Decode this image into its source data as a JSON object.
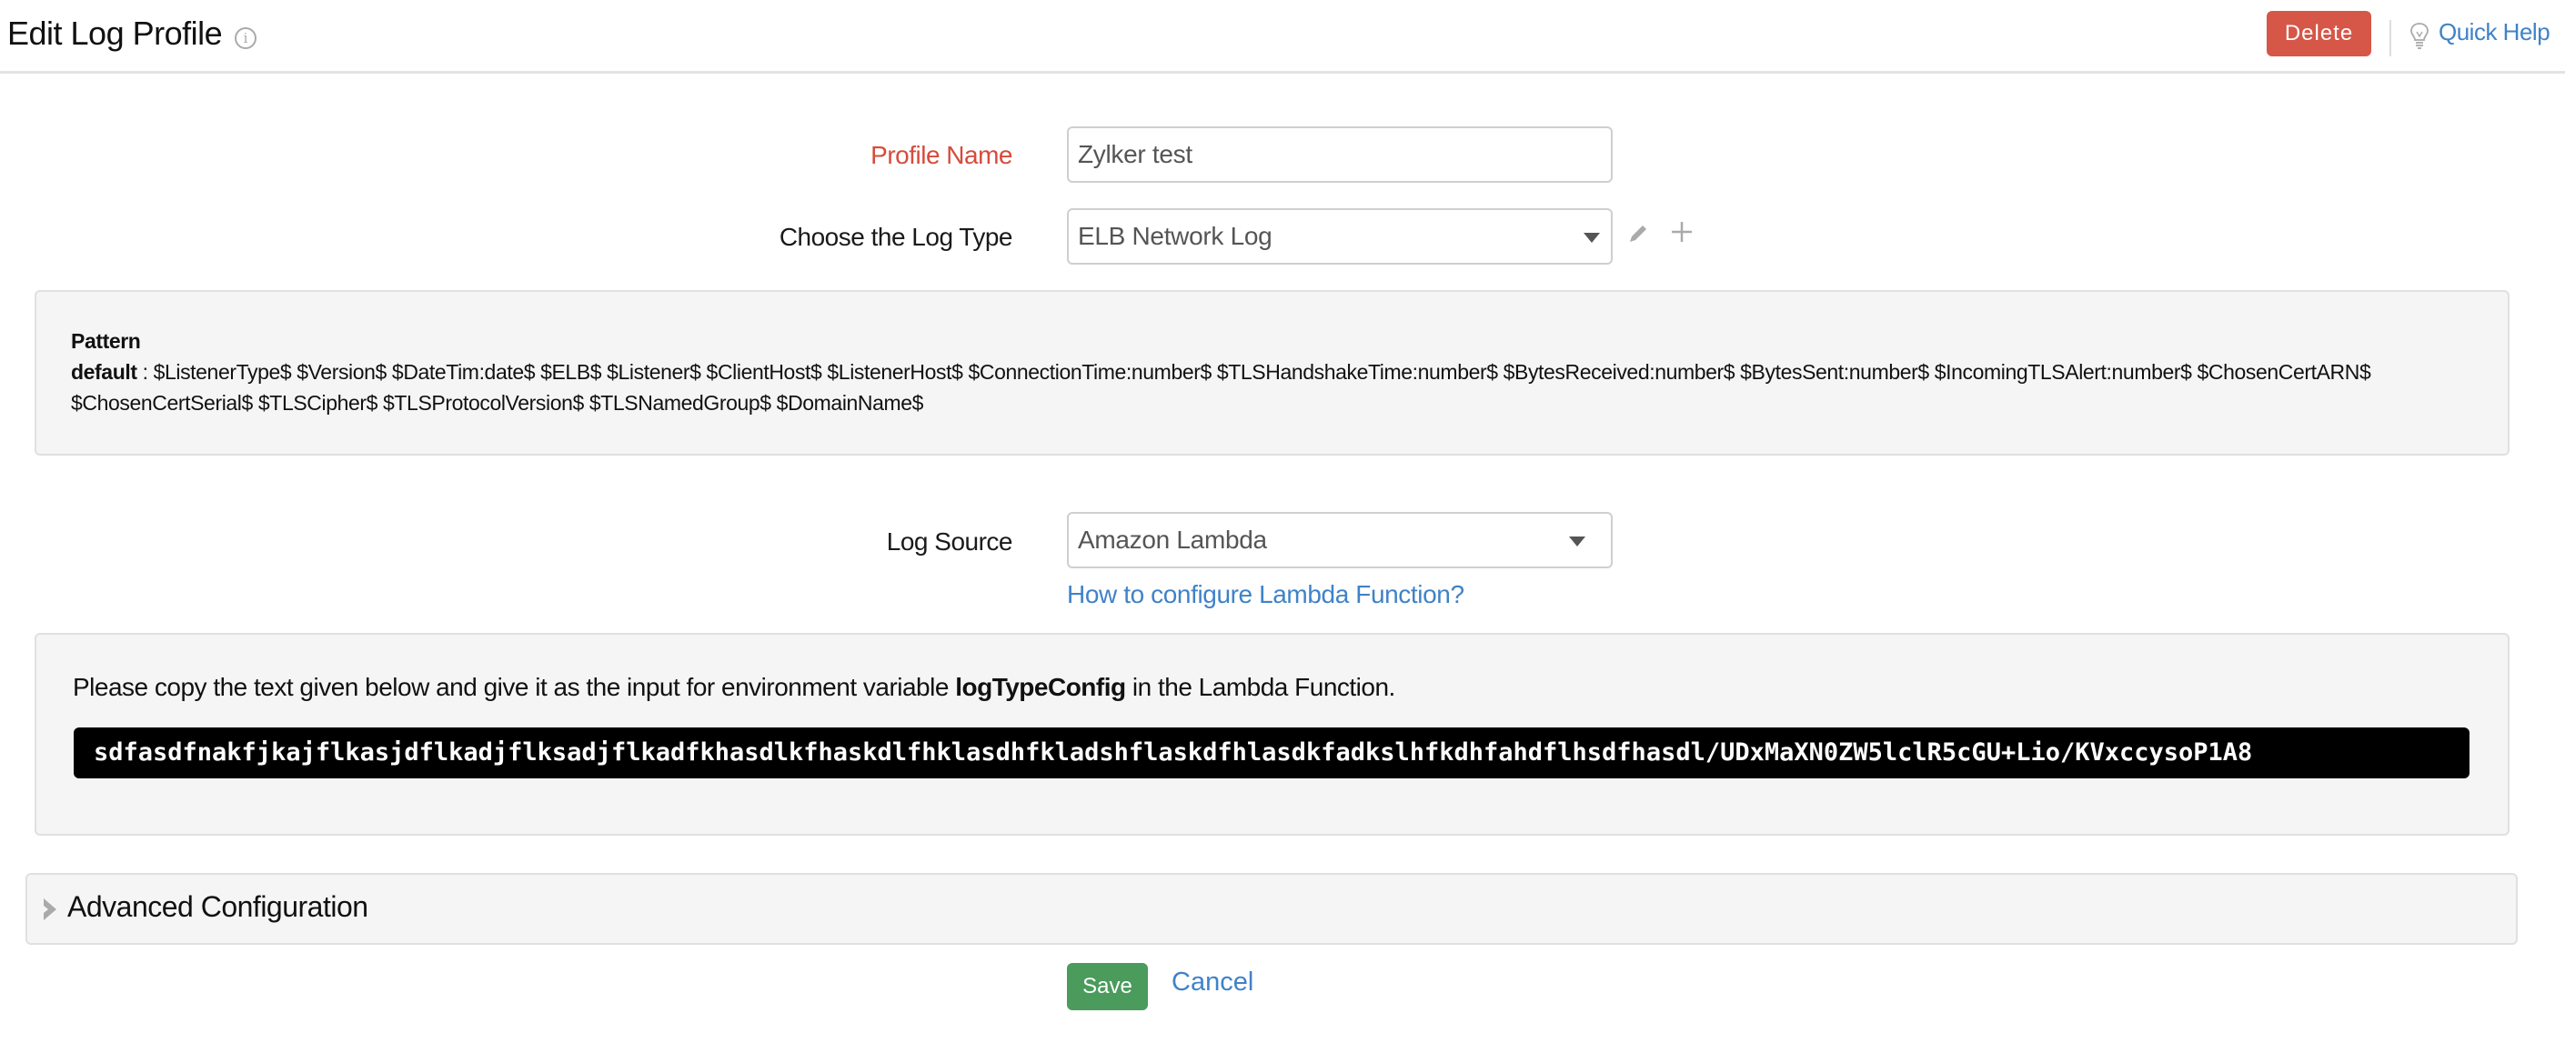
{
  "header": {
    "title": "Edit Log Profile",
    "info_icon": "info-circle-icon",
    "delete_label": "Delete",
    "quick_help_label": "Quick Help",
    "quick_help_icon": "lightbulb-icon"
  },
  "form": {
    "profile_name": {
      "label": "Profile Name",
      "value": "Zylker test",
      "required": true
    },
    "log_type": {
      "label": "Choose the Log Type",
      "value": "ELB Network Log",
      "edit_icon": "pencil-icon",
      "add_icon": "plus-icon"
    },
    "pattern": {
      "heading": "Pattern",
      "key": "default",
      "separator": " : ",
      "value": "$ListenerType$ $Version$ $DateTim:date$ $ELB$ $Listener$ $ClientHost$ $ListenerHost$ $ConnectionTime:number$ $TLSHandshakeTime:number$ $BytesReceived:number$ $BytesSent:number$ $IncomingTLSAlert:number$ $ChosenCertARN$ $ChosenCertSerial$ $TLSCipher$ $TLSProtocolVersion$ $TLSNamedGroup$ $DomainName$"
    },
    "log_source": {
      "label": "Log Source",
      "value": "Amazon Lambda",
      "help_link": "How to configure Lambda Function?"
    },
    "lambda_config": {
      "instruction_prefix": "Please copy the text given below and give it as the input for environment variable ",
      "variable_name": "logTypeConfig",
      "instruction_suffix": " in the Lambda Function.",
      "config_text": "sdfasdfnakfjkajflkasjdflkadjflksadjflkadfkhasdlkfhaskdlfhklasdhfkladshflaskdfhlasdkfadkslhfkdhfahdflhsdfhasdl/UDxMaXN0ZW5lclR5cGU+Lio/KVxccysoP1A8"
    },
    "advanced": {
      "label": "Advanced Configuration",
      "expanded": false
    }
  },
  "actions": {
    "save_label": "Save",
    "cancel_label": "Cancel"
  },
  "colors": {
    "danger": "#d65648",
    "success": "#4a9b5c",
    "link": "#3f82c8",
    "required_label": "#d64b3b"
  }
}
